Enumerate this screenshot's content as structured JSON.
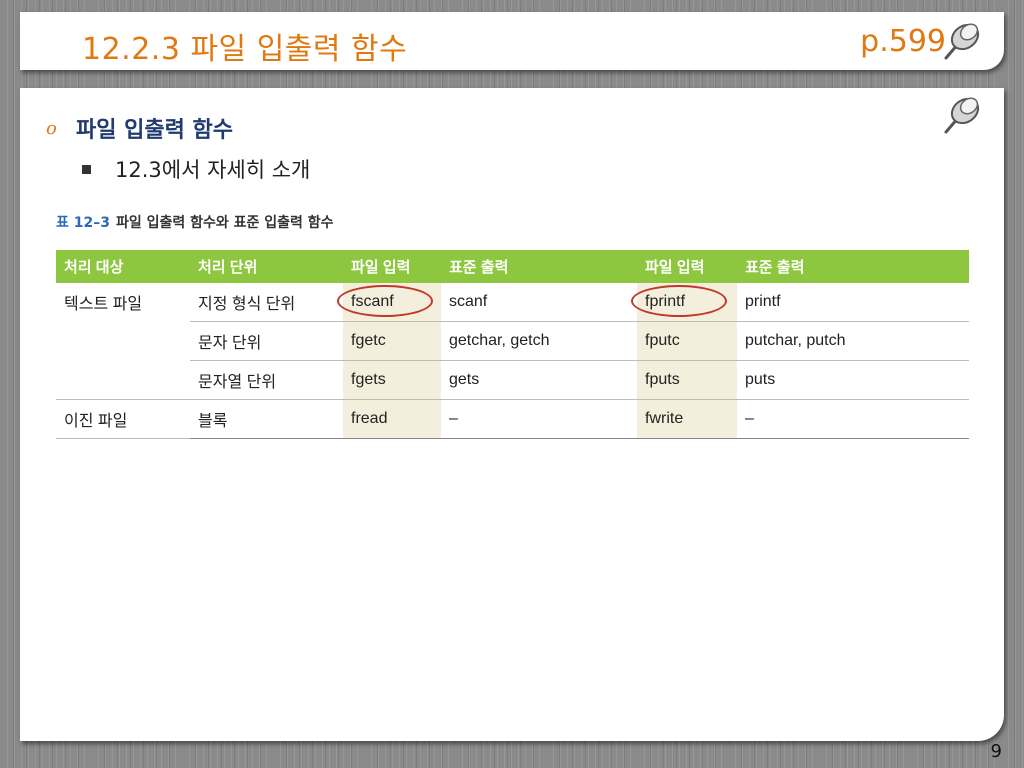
{
  "header": {
    "title": "12.2.3 파일 입출력 함수",
    "page_ref": "p.599"
  },
  "content": {
    "bullet_marker": "o",
    "bullet_title": "파일 입출력 함수",
    "sub_bullet": "12.3에서 자세히 소개"
  },
  "table": {
    "caption_number": "표 12–3",
    "caption_text": "파일 입출력 함수와 표준 입출력 함수",
    "headers": [
      "처리 대상",
      "처리 단위",
      "파일 입력",
      "표준 출력",
      "파일 입력",
      "표준 출력"
    ],
    "rows": [
      {
        "category": "텍스트 파일",
        "unit": "지정 형식 단위",
        "file_in": "fscanf",
        "std_in": "scanf",
        "file_out": "fprintf",
        "std_out": "printf"
      },
      {
        "category": "",
        "unit": "문자 단위",
        "file_in": "fgetc",
        "std_in": "getchar, getch",
        "file_out": "fputc",
        "std_out": "putchar, putch"
      },
      {
        "category": "",
        "unit": "문자열 단위",
        "file_in": "fgets",
        "std_in": "gets",
        "file_out": "fputs",
        "std_out": "puts"
      },
      {
        "category": "이진 파일",
        "unit": "블록",
        "file_in": "fread",
        "std_in": "–",
        "file_out": "fwrite",
        "std_out": "–"
      }
    ]
  },
  "footer": {
    "slide_number": "9"
  },
  "icons": {
    "pin": "pushpin-icon",
    "circle": "highlight-circle"
  },
  "colors": {
    "title": "#e07a10",
    "heading": "#1f3b70",
    "table_header": "#8dc63f",
    "highlight_column": "#f3efdc",
    "circle": "#c0392b"
  }
}
